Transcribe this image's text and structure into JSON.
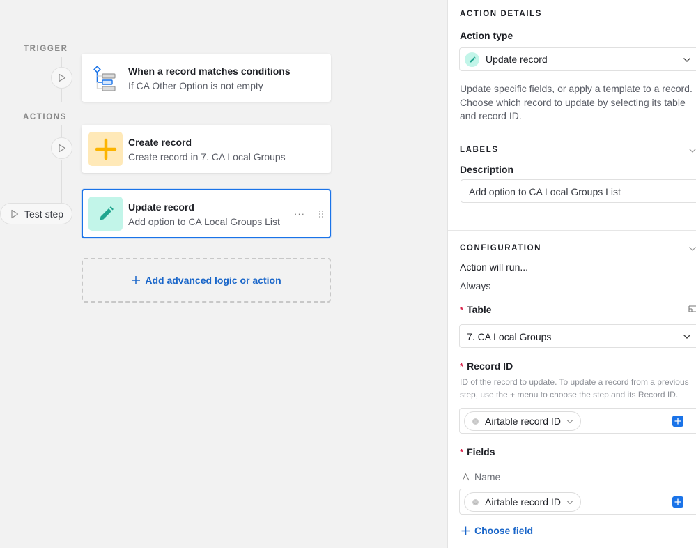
{
  "canvas": {
    "trigger_label": "TRIGGER",
    "actions_label": "ACTIONS",
    "trigger_card": {
      "title": "When a record matches conditions",
      "subtitle": "If CA Other Option is not empty",
      "icon": "conditions-tree-icon"
    },
    "action_cards": [
      {
        "title": "Create record",
        "subtitle": "Create record in 7. CA Local Groups",
        "icon": "plus-icon",
        "icon_bg": "#ffe9b8",
        "icon_color": "#fcb400"
      },
      {
        "title": "Update record",
        "subtitle": "Add option to CA Local Groups List",
        "icon": "pencil-icon",
        "icon_bg": "#c2f5e9",
        "icon_color": "#20a58f",
        "selected": true
      }
    ],
    "test_step_label": "Test step",
    "add_logic_label": "Add advanced logic or action"
  },
  "panel": {
    "action_details": {
      "section_title": "ACTION DETAILS",
      "action_type_label": "Action type",
      "action_type_value": "Update record",
      "description": "Update specific fields, or apply a template to a record. Choose which record to update by selecting its table and record ID."
    },
    "labels": {
      "section_title": "LABELS",
      "description_label": "Description",
      "description_value": "Add option to CA Local Groups List"
    },
    "configuration": {
      "section_title": "CONFIGURATION",
      "run_label": "Action will run...",
      "run_value": "Always",
      "table_label": "Table",
      "table_value": "7. CA Local Groups",
      "record_id_label": "Record ID",
      "record_id_hint": "ID of the record to update. To update a record from a previous step, use the + menu to choose the step and its Record ID.",
      "record_id_pill": "Airtable record ID",
      "fields_label": "Fields",
      "field_name": "Name",
      "field_pill": "Airtable record ID",
      "choose_field_label": "Choose field",
      "required_marker": "*"
    }
  },
  "colors": {
    "accent": "#1a73e8",
    "link": "#1a66c9",
    "required": "#d9234b"
  }
}
